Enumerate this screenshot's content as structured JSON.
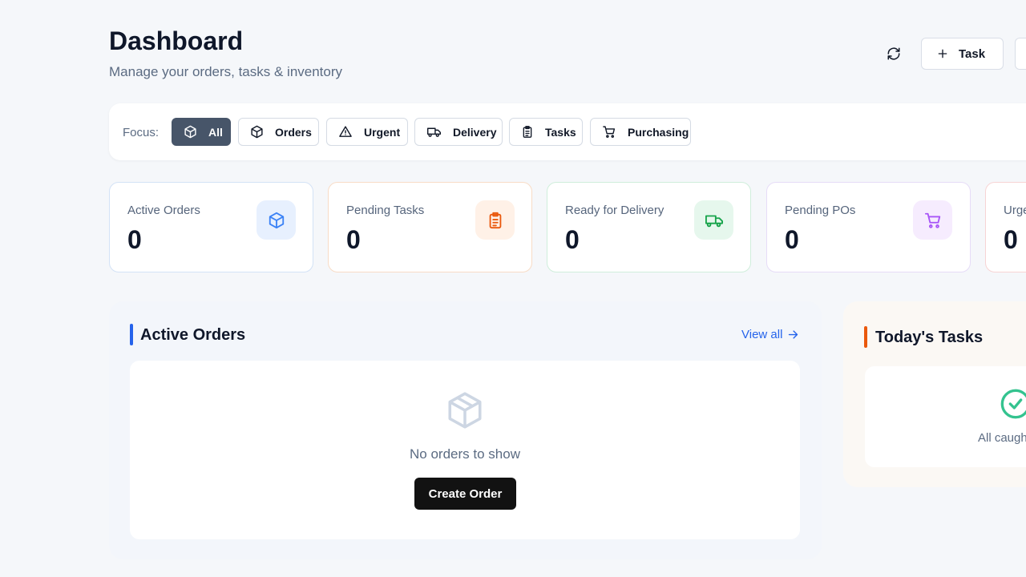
{
  "header": {
    "title": "Dashboard",
    "subtitle": "Manage your orders, tasks & inventory",
    "task_button_label": "Task"
  },
  "focus": {
    "label": "Focus:",
    "chips": [
      {
        "label": "All",
        "icon": "box-icon",
        "active": true
      },
      {
        "label": "Orders",
        "icon": "box-icon",
        "active": false
      },
      {
        "label": "Urgent",
        "icon": "warning-icon",
        "active": false
      },
      {
        "label": "Delivery",
        "icon": "truck-icon",
        "active": false
      },
      {
        "label": "Tasks",
        "icon": "clipboard-icon",
        "active": false
      },
      {
        "label": "Purchasing",
        "icon": "cart-icon",
        "active": false
      }
    ]
  },
  "stats": [
    {
      "label": "Active Orders",
      "value": "0",
      "icon": "box-icon",
      "color": "#3b82f6"
    },
    {
      "label": "Pending Tasks",
      "value": "0",
      "icon": "clipboard-icon",
      "color": "#ea580c"
    },
    {
      "label": "Ready for Delivery",
      "value": "0",
      "icon": "truck-icon",
      "color": "#16a34a"
    },
    {
      "label": "Pending POs",
      "value": "0",
      "icon": "cart-icon",
      "color": "#a855f7"
    },
    {
      "label": "Urge",
      "value": "0",
      "icon": "warning-icon",
      "color": "#ef4444"
    }
  ],
  "active_orders": {
    "title": "Active Orders",
    "view_all": "View all",
    "empty_text": "No orders to show",
    "create_label": "Create Order"
  },
  "todays_tasks": {
    "title": "Today's Tasks",
    "empty_text": "All caugh"
  }
}
